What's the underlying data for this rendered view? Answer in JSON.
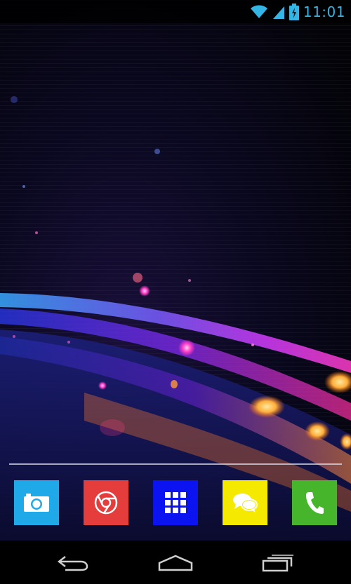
{
  "status_bar": {
    "time": "11:01",
    "icons": [
      "wifi-icon",
      "cell-signal-icon",
      "battery-charging-icon"
    ],
    "accent": "#33b5e5"
  },
  "dock": {
    "apps": [
      {
        "icon": "camera-icon",
        "color": "#1fa9e9"
      },
      {
        "icon": "chrome-icon",
        "color": "#e53c3c"
      },
      {
        "icon": "app-drawer-icon",
        "color": "#0b14f0"
      },
      {
        "icon": "messaging-icon",
        "color": "#f6e900"
      },
      {
        "icon": "phone-icon",
        "color": "#46b52c"
      }
    ]
  },
  "nav_bar": {
    "buttons": [
      "back-icon",
      "home-icon",
      "recent-apps-icon"
    ]
  }
}
